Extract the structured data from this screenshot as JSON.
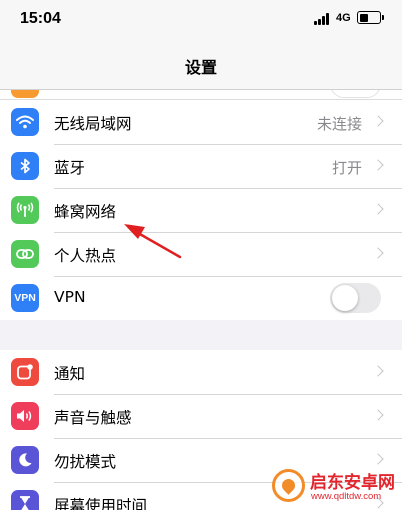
{
  "status_bar": {
    "time": "15:04",
    "network": "4G",
    "battery_level": 0.45
  },
  "nav": {
    "title": "设置"
  },
  "group_connectivity": [
    {
      "label": "无线局域网",
      "value": "未连接",
      "icon": "wifi-icon",
      "color": "#2f7ff6"
    },
    {
      "label": "蓝牙",
      "value": "打开",
      "icon": "bluetooth-icon",
      "color": "#2f7ff6"
    },
    {
      "label": "蜂窝网络",
      "value": "",
      "icon": "cellular-antenna-icon",
      "color": "#53c95a"
    },
    {
      "label": "个人热点",
      "value": "",
      "icon": "personal-hotspot-icon",
      "color": "#53c95a"
    },
    {
      "label": "VPN",
      "icon_text": "VPN",
      "toggle": false,
      "icon": "vpn-icon",
      "color": "#2f7ff6"
    }
  ],
  "group_system": [
    {
      "label": "通知",
      "icon": "notifications-icon",
      "color": "#ee4a3e"
    },
    {
      "label": "声音与触感",
      "icon": "speaker-icon",
      "color": "#ee3e5b"
    },
    {
      "label": "勿扰模式",
      "icon": "moon-icon",
      "color": "#5a55d6"
    },
    {
      "label": "屏幕使用时间",
      "icon": "hourglass-icon",
      "color": "#5a55d6"
    }
  ],
  "annotation": {
    "arrow_color": "#e02020",
    "points_to": "蜂窝网络"
  },
  "watermark": {
    "title": "启东安卓网",
    "url": "www.qdltdw.com"
  }
}
